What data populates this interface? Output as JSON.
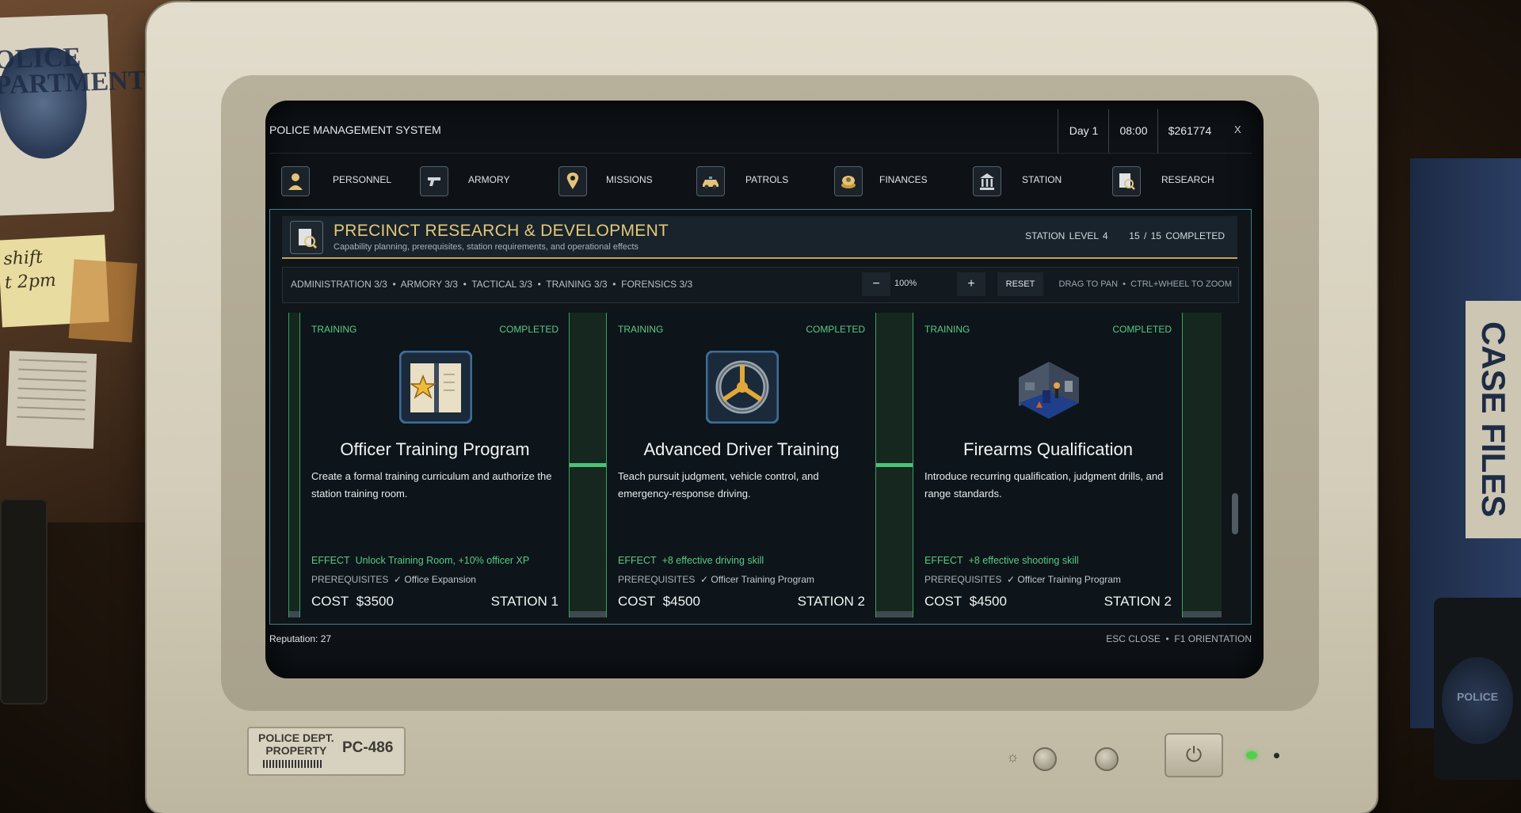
{
  "environment": {
    "poster_text": "OLICE\nPARTMENT",
    "sticky_note": "shift\nt 2pm",
    "binder_label": "CASE FILES",
    "mug_text": "POLICE",
    "monitor_label_line1": "POLICE DEPT.\nPROPERTY",
    "monitor_label_line2": "PC-486"
  },
  "titlebar": {
    "title": "POLICE MANAGEMENT SYSTEM",
    "day": "Day 1",
    "time": "08:00",
    "money": "$261774",
    "close": "X"
  },
  "tabs": [
    {
      "label": "PERSONNEL",
      "icon": "officer-icon"
    },
    {
      "label": "ARMORY",
      "icon": "pistol-icon"
    },
    {
      "label": "MISSIONS",
      "icon": "map-pin-icon"
    },
    {
      "label": "PATROLS",
      "icon": "patrol-car-icon"
    },
    {
      "label": "FINANCES",
      "icon": "money-icon"
    },
    {
      "label": "STATION",
      "icon": "building-icon"
    },
    {
      "label": "RESEARCH",
      "icon": "research-icon"
    }
  ],
  "panel": {
    "title": "PRECINCT RESEARCH & DEVELOPMENT",
    "subtitle": "Capability planning, prerequisites, station requirements, and operational effects",
    "station_level": "STATION LEVEL 4",
    "completed": "15 / 15 COMPLETED",
    "filters": "ADMINISTRATION 3/3  •  ARMORY 3/3  •  TACTICAL 3/3  •  TRAINING 3/3  •  FORENSICS 3/3",
    "zoom_minus": "−",
    "zoom_value": "100%",
    "zoom_plus": "+",
    "reset": "RESET",
    "hint": "DRAG TO PAN  •  CTRL+WHEEL TO ZOOM"
  },
  "cards": [
    {
      "category": "TRAINING",
      "status": "COMPLETED",
      "art": "manual-star-icon",
      "name": "Officer Training Program",
      "description": "Create a formal training curriculum and authorize the station training room.",
      "effect_label": "EFFECT",
      "effect": "Unlock Training Room, +10% officer XP",
      "prereq_label": "PREREQUISITES",
      "prereq": "✓ Office Expansion",
      "cost_label": "COST",
      "cost": "$3500",
      "station": "STATION 1"
    },
    {
      "category": "TRAINING",
      "status": "COMPLETED",
      "art": "steering-wheel-icon",
      "name": "Advanced Driver Training",
      "description": "Teach pursuit judgment, vehicle control, and emergency-response driving.",
      "effect_label": "EFFECT",
      "effect": "+8 effective driving skill",
      "prereq_label": "PREREQUISITES",
      "prereq": "✓ Officer Training Program",
      "cost_label": "COST",
      "cost": "$4500",
      "station": "STATION 2"
    },
    {
      "category": "TRAINING",
      "status": "COMPLETED",
      "art": "firing-range-room-icon",
      "name": "Firearms Qualification",
      "description": "Introduce recurring qualification, judgment drills, and range standards.",
      "effect_label": "EFFECT",
      "effect": "+8 effective shooting skill",
      "prereq_label": "PREREQUISITES",
      "prereq": "✓ Officer Training Program",
      "cost_label": "COST",
      "cost": "$4500",
      "station": "STATION 2"
    }
  ],
  "footer": {
    "reputation": "Reputation: 27",
    "shortcuts": "ESC CLOSE  •  F1 ORIENTATION"
  },
  "colors": {
    "accent_gold": "#e6c878",
    "completed_green": "#5cc985",
    "panel_border": "#3d7f8f"
  }
}
